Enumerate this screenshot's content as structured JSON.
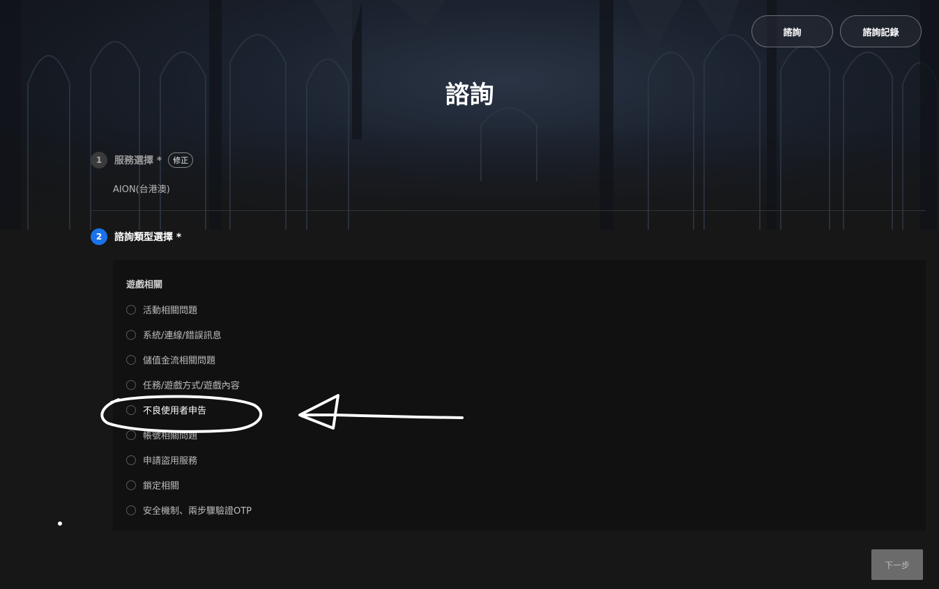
{
  "header": {
    "inquiry_button": "諮詢",
    "history_button": "諮詢記錄",
    "page_title": "諮詢"
  },
  "step1": {
    "number": "1",
    "title": "服務選擇 *",
    "edit_label": "修正",
    "selected_value": "AION(台港澳)"
  },
  "step2": {
    "number": "2",
    "title": "諮詢類型選擇 *",
    "group_title": "遊戲相關",
    "options": [
      {
        "label": "活動相關問題"
      },
      {
        "label": "系統/連線/錯誤訊息"
      },
      {
        "label": "儲值金流相關問題"
      },
      {
        "label": "任務/遊戲方式/遊戲內容"
      },
      {
        "label": "不良使用者申告"
      },
      {
        "label": "帳號相關問題"
      },
      {
        "label": "申請盜用服務"
      },
      {
        "label": "鎖定相關"
      },
      {
        "label": "安全機制、兩步驟驗證OTP"
      }
    ]
  },
  "footer": {
    "next_button": "下一步"
  },
  "colors": {
    "accent": "#1a73e8",
    "background": "#171717",
    "panel": "#111111"
  }
}
